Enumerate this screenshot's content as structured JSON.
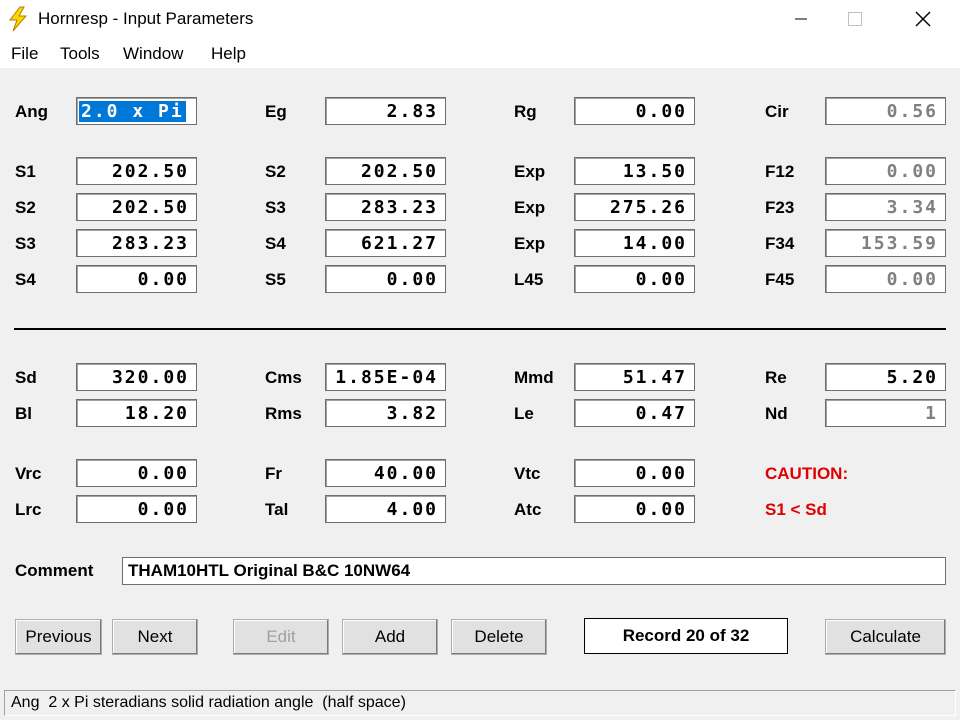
{
  "window": {
    "title": "Hornresp - Input Parameters",
    "icon": "lightning-bolt-icon"
  },
  "menu": [
    "File",
    "Tools",
    "Window",
    "Help"
  ],
  "horn": {
    "ang": {
      "label": "Ang",
      "value": "2.0 x Pi"
    },
    "eg": {
      "label": "Eg",
      "value": "2.83"
    },
    "rg": {
      "label": "Rg",
      "value": "0.00"
    },
    "cir": {
      "label": "Cir",
      "value": "0.56"
    },
    "r1": {
      "a": {
        "label": "S1",
        "value": "202.50"
      },
      "b": {
        "label": "S2",
        "value": "202.50"
      },
      "c": {
        "label": "Exp",
        "value": "13.50"
      },
      "d": {
        "label": "F12",
        "value": "0.00"
      }
    },
    "r2": {
      "a": {
        "label": "S2",
        "value": "202.50"
      },
      "b": {
        "label": "S3",
        "value": "283.23"
      },
      "c": {
        "label": "Exp",
        "value": "275.26"
      },
      "d": {
        "label": "F23",
        "value": "3.34"
      }
    },
    "r3": {
      "a": {
        "label": "S3",
        "value": "283.23"
      },
      "b": {
        "label": "S4",
        "value": "621.27"
      },
      "c": {
        "label": "Exp",
        "value": "14.00"
      },
      "d": {
        "label": "F34",
        "value": "153.59"
      }
    },
    "r4": {
      "a": {
        "label": "S4",
        "value": "0.00"
      },
      "b": {
        "label": "S5",
        "value": "0.00"
      },
      "c": {
        "label": "L45",
        "value": "0.00"
      },
      "d": {
        "label": "F45",
        "value": "0.00"
      }
    }
  },
  "driver": {
    "r1": {
      "a": {
        "label": "Sd",
        "value": "320.00"
      },
      "b": {
        "label": "Cms",
        "value": "1.85E-04"
      },
      "c": {
        "label": "Mmd",
        "value": "51.47"
      },
      "d": {
        "label": "Re",
        "value": "5.20"
      }
    },
    "r2": {
      "a": {
        "label": "Bl",
        "value": "18.20"
      },
      "b": {
        "label": "Rms",
        "value": "3.82"
      },
      "c": {
        "label": "Le",
        "value": "0.47"
      },
      "d": {
        "label": "Nd",
        "value": "1"
      }
    },
    "r3": {
      "a": {
        "label": "Vrc",
        "value": "0.00"
      },
      "b": {
        "label": "Fr",
        "value": "40.00"
      },
      "c": {
        "label": "Vtc",
        "value": "0.00"
      }
    },
    "r4": {
      "a": {
        "label": "Lrc",
        "value": "0.00"
      },
      "b": {
        "label": "Tal",
        "value": "4.00"
      },
      "c": {
        "label": "Atc",
        "value": "0.00"
      }
    }
  },
  "caution": {
    "title": "CAUTION:",
    "message": "S1 < Sd"
  },
  "comment": {
    "label": "Comment",
    "value": "THAM10HTL Original B&C 10NW64"
  },
  "buttons": {
    "previous": "Previous",
    "next": "Next",
    "edit": "Edit",
    "add": "Add",
    "delete": "Delete",
    "calculate": "Calculate"
  },
  "record": "Record 20 of 32",
  "status": "Ang  2 x Pi steradians solid radiation angle  (half space)",
  "colors": {
    "caution": "#e00000",
    "selection": "#0078d7"
  }
}
